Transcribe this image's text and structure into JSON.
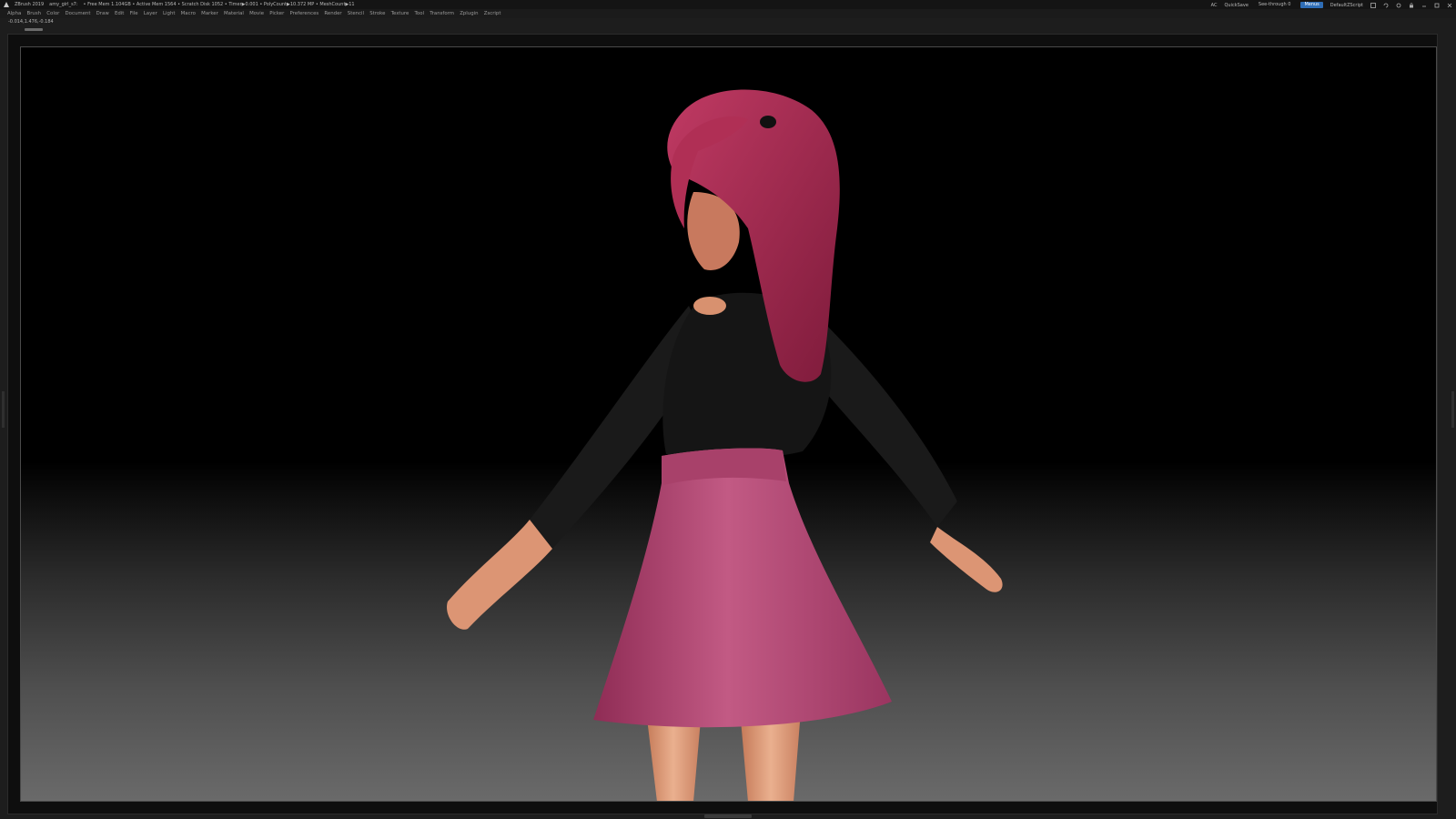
{
  "titlebar": {
    "app": "ZBrush 2019",
    "file": "amy_girl_s7:",
    "stats": "• Free Mem 1.104GB • Active Mem 1564 • Scratch Disk 1052 • Timer▶0.001 • PolyCount▶10.372 MP • MeshCount▶11",
    "ac": "AC",
    "quicksave": "QuickSave",
    "seethrough": "See-through 0",
    "menus": "Menus",
    "script": "DefaultZScript"
  },
  "menubar": {
    "items": [
      "Alpha",
      "Brush",
      "Color",
      "Document",
      "Draw",
      "Edit",
      "File",
      "Layer",
      "Light",
      "Macro",
      "Marker",
      "Material",
      "Movie",
      "Picker",
      "Preferences",
      "Render",
      "Stencil",
      "Stroke",
      "Texture",
      "Tool",
      "Transform",
      "Zplugin",
      "Zscript"
    ]
  },
  "coords": "-0.014,1.476,-0.184",
  "colors": {
    "hair": "#b0335a",
    "top": "#141414",
    "skirt": "#b4456f",
    "skin": "#e7a17d"
  }
}
